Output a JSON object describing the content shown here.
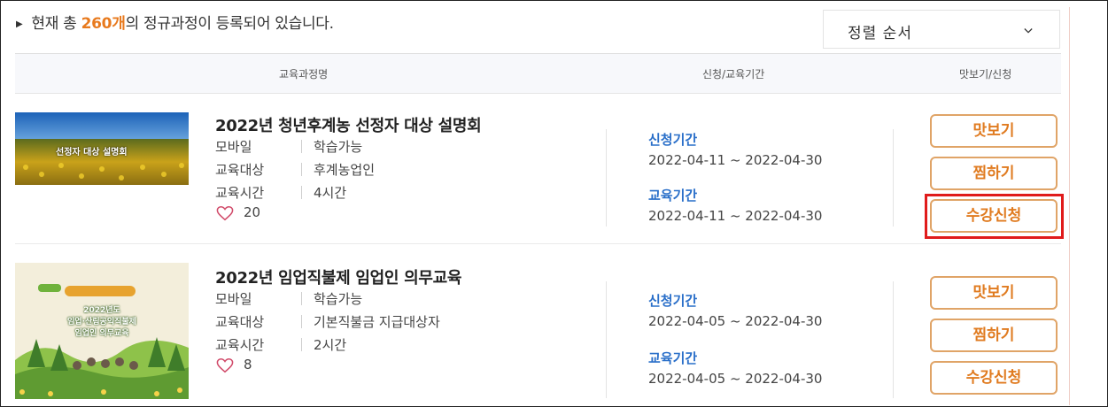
{
  "summary": {
    "prefix": "현재 총 ",
    "count": "260개",
    "suffix": "의 정규과정이 등록되어 있습니다."
  },
  "sort": {
    "label": "정렬 순서"
  },
  "table_header": {
    "course_name": "교육과정명",
    "period": "신청/교육기간",
    "actions": "맛보기/신청"
  },
  "courses": [
    {
      "title": "2022년 청년후계농 선정자 대상 설명회",
      "thumb_text": "선정자 대상 설명회",
      "rows": [
        {
          "key": "모바일",
          "value": "학습가능"
        },
        {
          "key": "교육대상",
          "value": "후계농업인"
        },
        {
          "key": "교육시간",
          "value": "4시간"
        }
      ],
      "likes": "20",
      "apply_label": "신청기간",
      "apply_period": "2022-04-11 ~ 2022-04-30",
      "edu_label": "교육기간",
      "edu_period": "2022-04-11 ~ 2022-04-30",
      "preview": "맛보기",
      "wish": "찜하기",
      "enroll": "수강신청"
    },
    {
      "title": "2022년 임업직불제 임업인 의무교육",
      "thumb_text": [
        "2022년도",
        "임업·산림공익직불제",
        "임업인 의무교육"
      ],
      "rows": [
        {
          "key": "모바일",
          "value": "학습가능"
        },
        {
          "key": "교육대상",
          "value": "기본직불금 지급대상자"
        },
        {
          "key": "교육시간",
          "value": "2시간"
        }
      ],
      "likes": "8",
      "apply_label": "신청기간",
      "apply_period": "2022-04-05 ~ 2022-04-30",
      "edu_label": "교육기간",
      "edu_period": "2022-04-05 ~ 2022-04-30",
      "preview": "맛보기",
      "wish": "찜하기",
      "enroll": "수강신청"
    }
  ],
  "colors": {
    "accent": "#e07b20",
    "link": "#2a6fc9",
    "highlight": "#e01b1b"
  }
}
